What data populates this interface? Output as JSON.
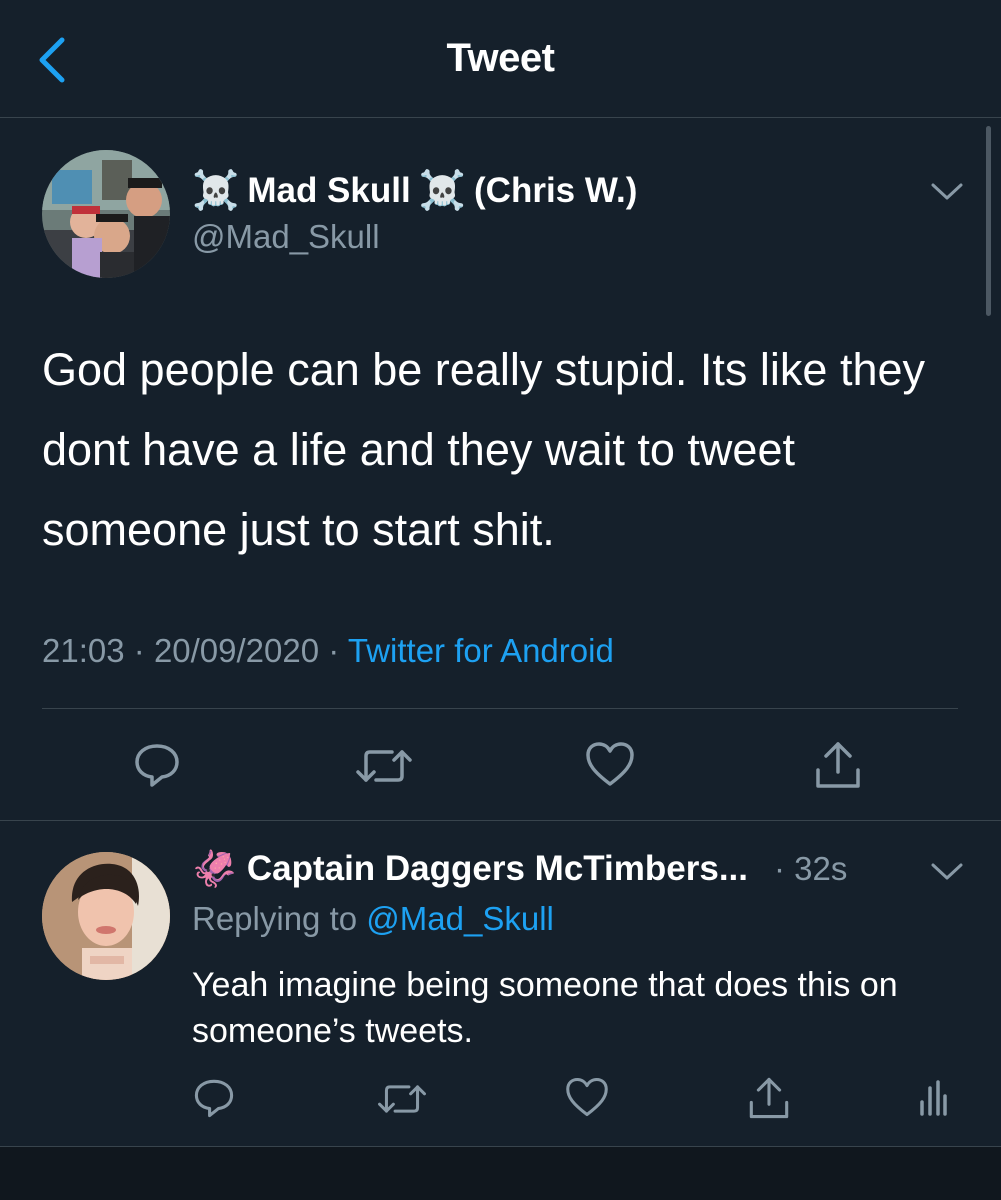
{
  "header": {
    "title": "Tweet"
  },
  "tweet": {
    "skull_emoji": "☠️",
    "display_name": "Mad Skull",
    "name_suffix": "(Chris W.)",
    "handle": "@Mad_Skull",
    "text": "God people can be really stupid. Its like they dont have a life and they wait to tweet someone just to start shit.",
    "time": "21:03",
    "date": "20/09/2020",
    "separator": "·",
    "source": "Twitter for Android"
  },
  "reply": {
    "emoji": "🦑",
    "display_name": "Captain Daggers McTimbers...",
    "time": "· 32s",
    "replying_prefix": "Replying to",
    "replying_to": "@Mad_Skull",
    "text": "Yeah imagine being someone that does this on someone’s tweets."
  },
  "colors": {
    "background": "#15202b",
    "accent": "#1da1f2",
    "secondary_text": "#8899a6",
    "divider": "#38444d"
  },
  "icons": {
    "back": "chevron-left-icon",
    "caret": "chevron-down-icon",
    "reply": "reply-icon",
    "retweet": "retweet-icon",
    "like": "heart-icon",
    "share": "share-icon",
    "analytics": "analytics-icon"
  }
}
